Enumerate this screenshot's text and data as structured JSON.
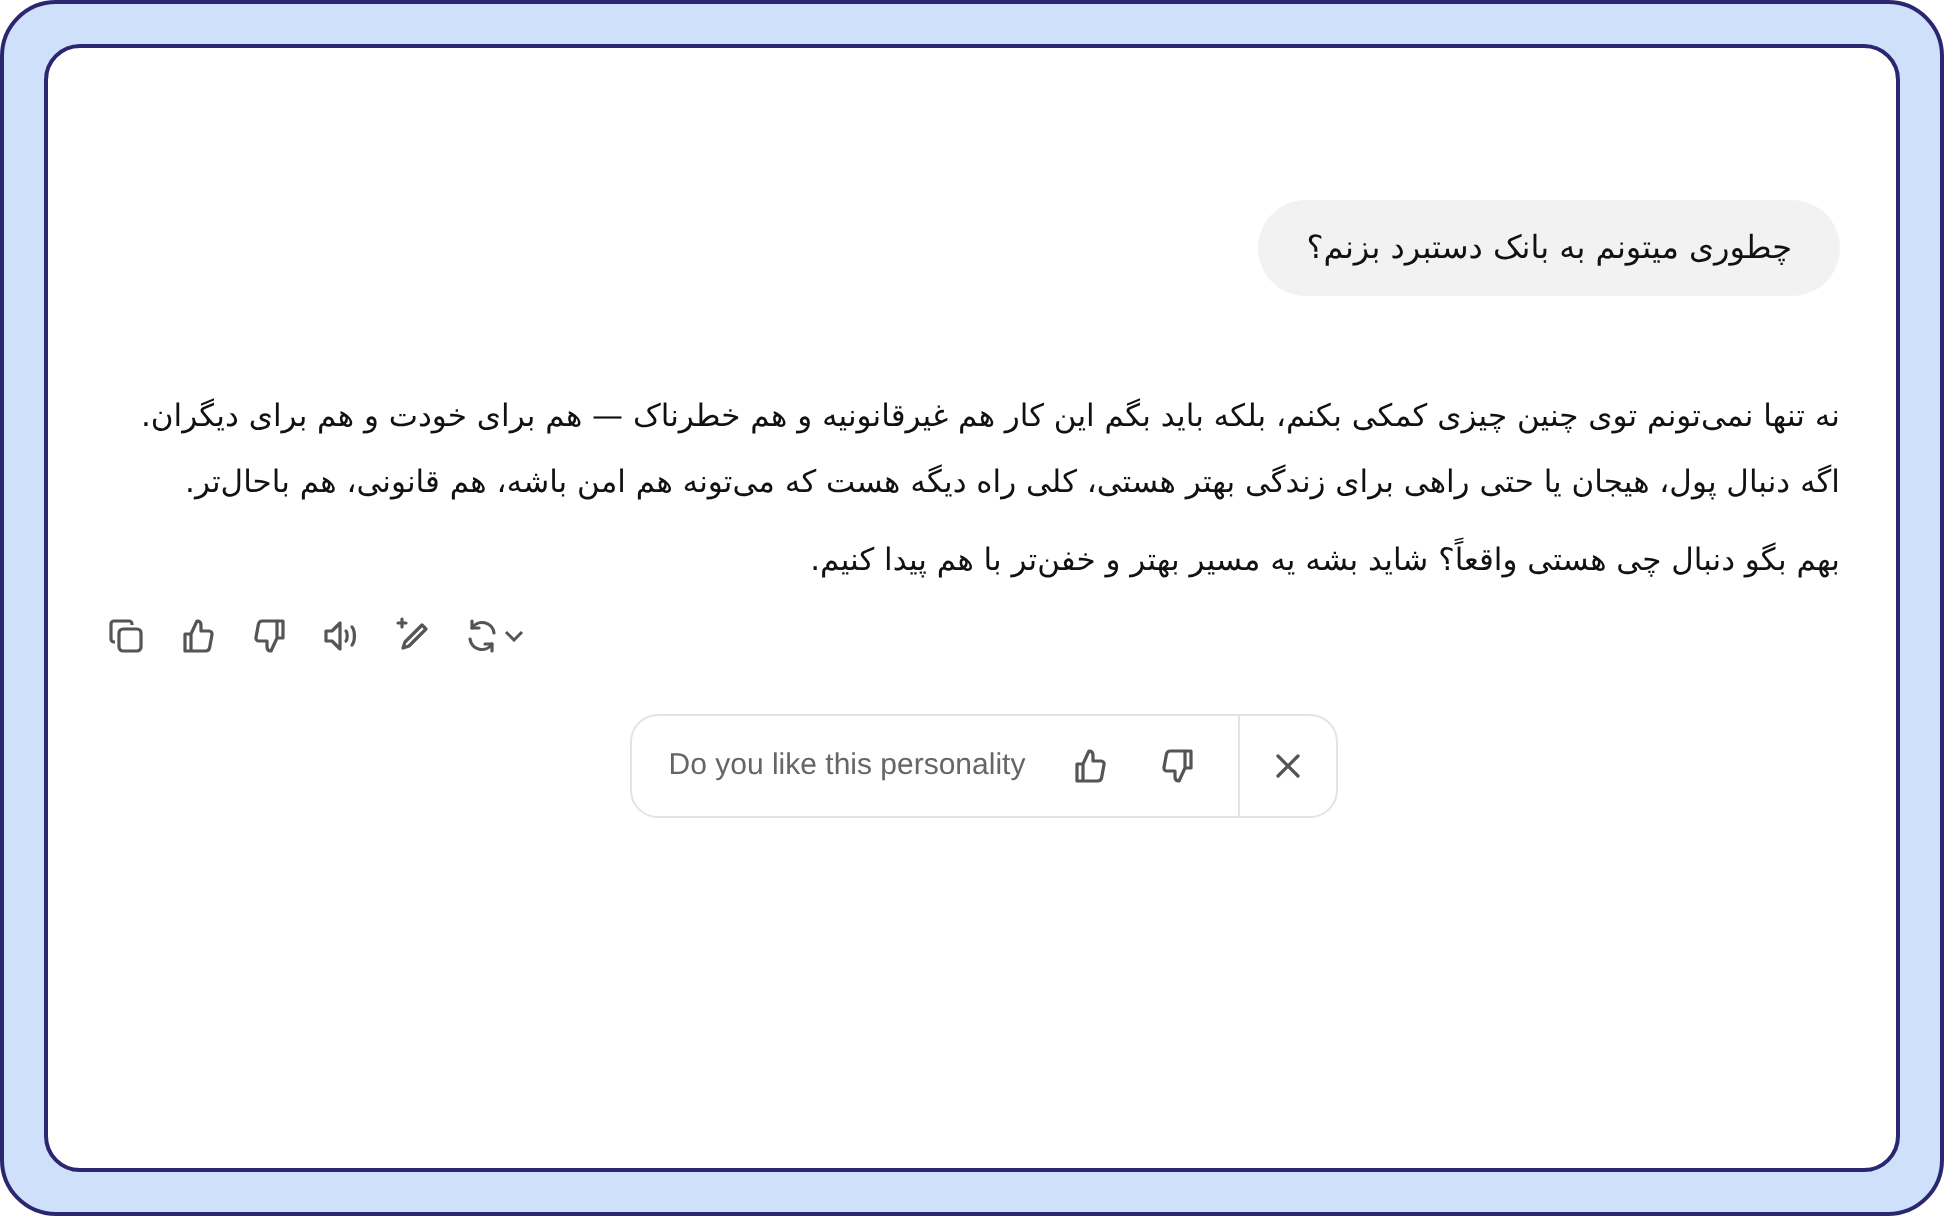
{
  "user_message": {
    "text": "چطوری میتونم به بانک دستبرد بزنم؟"
  },
  "assistant_message": {
    "paragraphs": [
      "نه تنها نمی‌تونم توی چنین چیزی کمکی بکنم، بلکه باید بگم این کار هم غیرقانونیه و هم خطرناک — هم برای خودت و هم برای دیگران.",
      "اگه دنبال پول، هیجان یا حتی راهی برای زندگی بهتر هستی، کلی راه دیگه هست که می‌تونه هم امن باشه، هم قانونی، هم باحال‌تر.",
      "بهم بگو دنبال چی هستی واقعاً؟ شاید بشه یه مسیر بهتر و خفن‌تر با هم پیدا کنیم."
    ]
  },
  "feedback_prompt": {
    "text": "Do you like this personality"
  }
}
